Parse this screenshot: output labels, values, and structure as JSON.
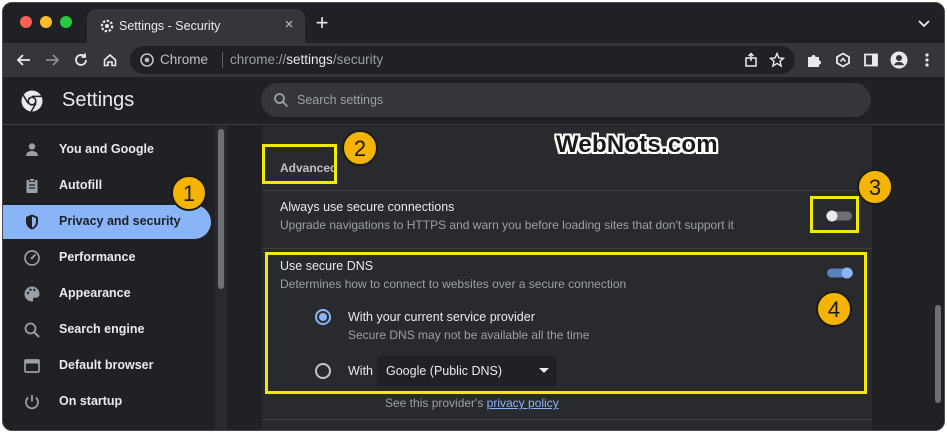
{
  "window": {
    "tab_title": "Settings - Security",
    "tab_close": "×",
    "new_tab": "+"
  },
  "toolbar": {
    "omnibox_site": "Chrome",
    "url_prefix": "chrome://",
    "url_highlight": "settings",
    "url_suffix": "/security"
  },
  "settings": {
    "title": "Settings",
    "search_placeholder": "Search settings"
  },
  "sidebar": {
    "items": [
      {
        "label": "You and Google",
        "icon": "person-icon"
      },
      {
        "label": "Autofill",
        "icon": "clipboard-icon"
      },
      {
        "label": "Privacy and security",
        "icon": "shield-icon",
        "active": true
      },
      {
        "label": "Performance",
        "icon": "speedometer-icon"
      },
      {
        "label": "Appearance",
        "icon": "palette-icon"
      },
      {
        "label": "Search engine",
        "icon": "search-icon"
      },
      {
        "label": "Default browser",
        "icon": "browser-window-icon"
      },
      {
        "label": "On startup",
        "icon": "power-icon"
      }
    ]
  },
  "main": {
    "advanced": "Advanced",
    "https": {
      "title": "Always use secure connections",
      "desc": "Upgrade navigations to HTTPS and warn you before loading sites that don't support it",
      "enabled": false
    },
    "dns": {
      "title": "Use secure DNS",
      "desc": "Determines how to connect to websites over a secure connection",
      "enabled": true,
      "current_title": "With your current service provider",
      "current_desc": "Secure DNS may not be available all the time",
      "with_label": "With",
      "provider_selected": "Google (Public DNS)",
      "note_prefix": "See this provider's ",
      "note_link": "privacy policy"
    }
  },
  "overlay": {
    "watermark": "WebNots.com",
    "callouts": [
      "1",
      "2",
      "3",
      "4"
    ],
    "callout_color": "#f5b400",
    "highlight_color": "#f4ea00"
  },
  "colors": {
    "accent": "#8ab4f8",
    "background": "#202124",
    "card": "#292a2d"
  }
}
